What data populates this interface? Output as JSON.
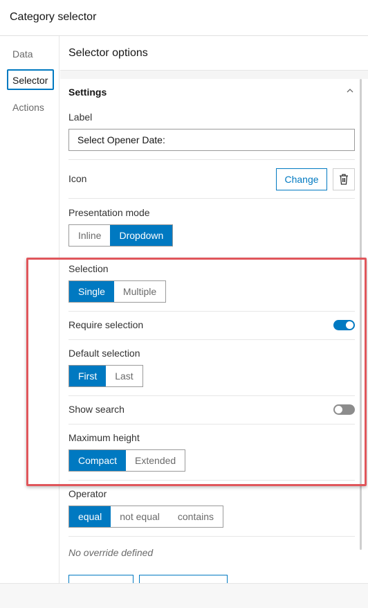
{
  "window": {
    "title": "Category selector"
  },
  "nav": {
    "items": [
      {
        "label": "Data"
      },
      {
        "label": "Selector"
      },
      {
        "label": "Actions"
      }
    ]
  },
  "main": {
    "title": "Selector options"
  },
  "settings": {
    "title": "Settings",
    "label_field": {
      "label": "Label",
      "value": "Select Opener Date:"
    },
    "icon": {
      "label": "Icon",
      "change_label": "Change",
      "delete_icon": "trash-icon"
    },
    "presentation": {
      "label": "Presentation mode",
      "options": [
        "Inline",
        "Dropdown"
      ],
      "selected": "Dropdown"
    },
    "selection": {
      "label": "Selection",
      "options": [
        "Single",
        "Multiple"
      ],
      "selected": "Single"
    },
    "require_selection": {
      "label": "Require selection",
      "on": true
    },
    "default_selection": {
      "label": "Default selection",
      "options": [
        "First",
        "Last"
      ],
      "selected": "First"
    },
    "show_search": {
      "label": "Show search",
      "on": false
    },
    "max_height": {
      "label": "Maximum height",
      "options": [
        "Compact",
        "Extended"
      ],
      "selected": "Compact"
    },
    "operator": {
      "label": "Operator",
      "options": [
        "equal",
        "not equal",
        "contains"
      ],
      "selected": "equal"
    },
    "override_note": "No override defined"
  },
  "colors": {
    "accent": "#0079c1",
    "highlight": "#e0565b"
  }
}
